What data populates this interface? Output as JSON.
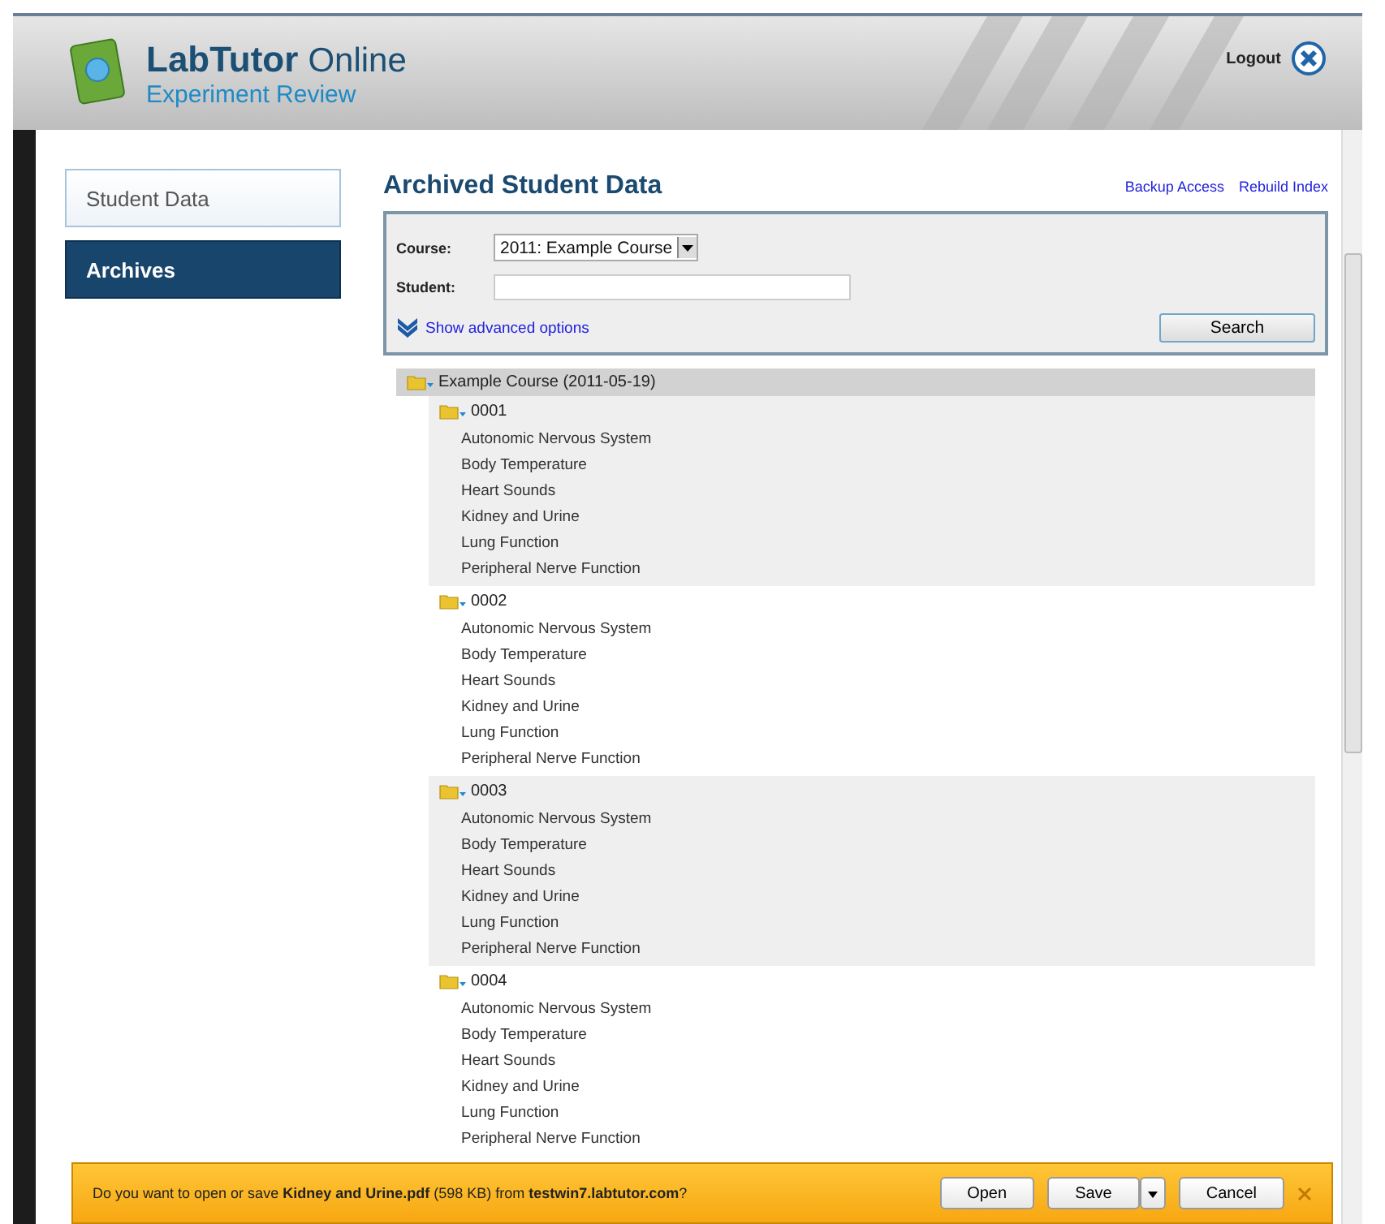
{
  "header": {
    "brand": "LabTutor",
    "brand_suffix": "Online",
    "subtitle": "Experiment Review",
    "logout": "Logout"
  },
  "sidebar": {
    "items": [
      {
        "label": "Student Data",
        "selected": false
      },
      {
        "label": "Archives",
        "selected": true
      }
    ]
  },
  "main": {
    "title": "Archived Student Data",
    "links": [
      "Backup Access",
      "Rebuild Index"
    ],
    "search_form": {
      "course_label": "Course:",
      "course_value": "2011: Example Course",
      "student_label": "Student:",
      "advanced_link": "Show advanced options",
      "search_button": "Search"
    },
    "tree": [
      {
        "label": "Example Course (2011-05-19)",
        "expanded": true,
        "children": [
          {
            "label": "0001",
            "expanded": true,
            "children": [
              "Autonomic Nervous System",
              "Body Temperature",
              "Heart Sounds",
              "Kidney and Urine",
              "Lung Function",
              "Peripheral Nerve Function"
            ]
          },
          {
            "label": "0002",
            "expanded": true,
            "children": [
              "Autonomic Nervous System",
              "Body Temperature",
              "Heart Sounds",
              "Kidney and Urine",
              "Lung Function",
              "Peripheral Nerve Function"
            ]
          },
          {
            "label": "0003",
            "expanded": true,
            "children": [
              "Autonomic Nervous System",
              "Body Temperature",
              "Heart Sounds",
              "Kidney and Urine",
              "Lung Function",
              "Peripheral Nerve Function"
            ]
          },
          {
            "label": "0004",
            "expanded": true,
            "children": [
              "Autonomic Nervous System",
              "Body Temperature",
              "Heart Sounds",
              "Kidney and Urine",
              "Lung Function",
              "Peripheral Nerve Function"
            ]
          }
        ]
      }
    ]
  },
  "download_bar": {
    "message": "Do you want to open or save **Kidney and Urine.pdf** (598 KB) from **testwin7.labtutor.com**?",
    "buttons": [
      "Open",
      "Save",
      "Cancel"
    ]
  }
}
